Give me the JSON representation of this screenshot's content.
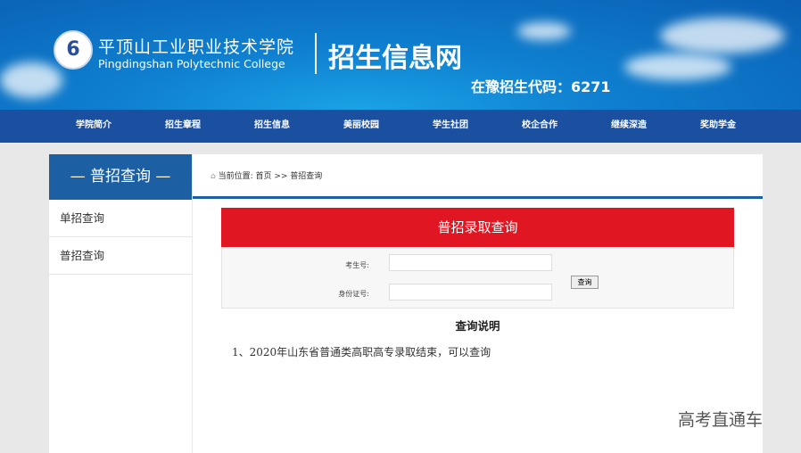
{
  "header": {
    "logo_text": "6",
    "college_cn": "平顶山工业职业技术学院",
    "college_en": "Pingdingshan Polytechnic College",
    "site_title": "招生信息网",
    "code": "在豫招生代码：6271"
  },
  "nav": [
    "学院简介",
    "招生章程",
    "招生信息",
    "美丽校园",
    "学生社团",
    "校企合作",
    "继续深造",
    "奖助学金"
  ],
  "sidebar": {
    "title": "—  普招查询  —",
    "items": [
      "单招查询",
      "普招查询"
    ]
  },
  "breadcrumb": "当前位置: 首页 >> 普招查询",
  "query": {
    "title": "普招录取查询",
    "exam_no_label": "考生号:",
    "exam_no_value": "",
    "id_label": "身份证号:",
    "id_value": "",
    "submit": "查询"
  },
  "notes": {
    "title": "查询说明",
    "items": [
      "1、2020年山东省普通类高职高专录取结束，可以查询"
    ]
  },
  "watermark": "高考直通车"
}
